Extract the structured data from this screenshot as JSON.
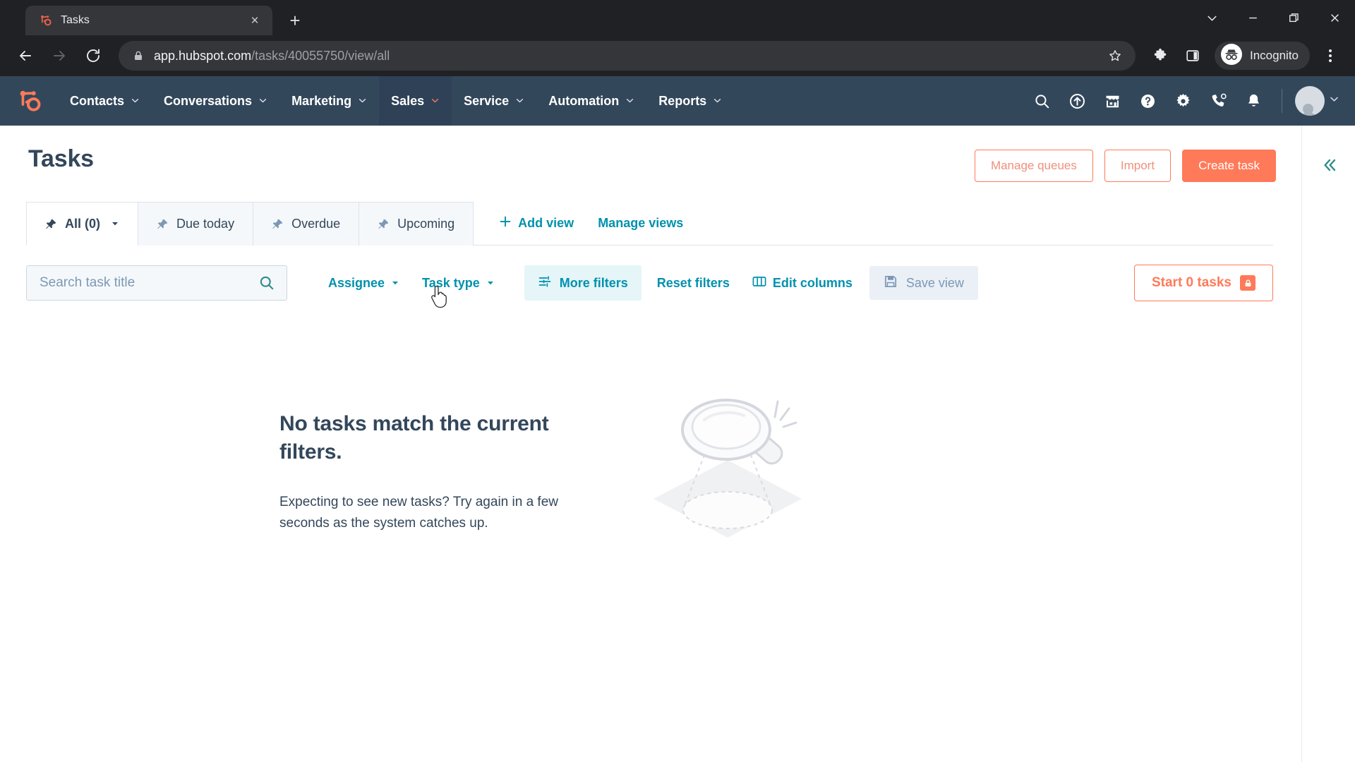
{
  "browser": {
    "tab": {
      "title": "Tasks",
      "favicon": "hubspot-sprocket-icon",
      "close": "×"
    },
    "new_tab_label": "+",
    "window_controls": [
      {
        "name": "tab-search-chevron",
        "glyph": "⌄"
      },
      {
        "name": "minimize",
        "glyph": "—"
      },
      {
        "name": "maximize",
        "glyph": "❐"
      },
      {
        "name": "close",
        "glyph": "✕"
      }
    ],
    "nav": {
      "back": "←",
      "forward": "→",
      "reload": "⟳"
    },
    "omnibox": {
      "host": "app.hubspot.com",
      "path": "/tasks/40055750/view/all",
      "lock": "lock-icon",
      "star": "bookmark-star-icon"
    },
    "extensions_icon": "puzzle-icon",
    "sidepanel_icon": "side-panel-icon",
    "incognito_label": "Incognito",
    "menu_icon": "three-dot-menu-icon"
  },
  "hubspot_nav": {
    "logo": "hubspot-sprocket-logo",
    "menu": [
      {
        "label": "Contacts",
        "active": false
      },
      {
        "label": "Conversations",
        "active": false
      },
      {
        "label": "Marketing",
        "active": false
      },
      {
        "label": "Sales",
        "active": true
      },
      {
        "label": "Service",
        "active": false
      },
      {
        "label": "Automation",
        "active": false
      },
      {
        "label": "Reports",
        "active": false
      }
    ],
    "icons": [
      "search-icon",
      "upgrade-icon",
      "marketplace-icon",
      "help-icon",
      "settings-gear-icon",
      "calling-phone-icon",
      "notifications-bell-icon"
    ],
    "avatar": "user-avatar",
    "avatar_caret": "⌄"
  },
  "page": {
    "title": "Tasks",
    "actions": {
      "manage_queues": "Manage queues",
      "import": "Import",
      "create_task": "Create task"
    },
    "collapse_panel_icon": "double-chevron-left-icon"
  },
  "views": {
    "tabs": [
      {
        "label": "All (0)",
        "active": true,
        "has_caret": true
      },
      {
        "label": "Due today",
        "active": false,
        "has_caret": false
      },
      {
        "label": "Overdue",
        "active": false,
        "has_caret": false
      },
      {
        "label": "Upcoming",
        "active": false,
        "has_caret": false
      }
    ],
    "add_view": "Add view",
    "manage_views": "Manage views"
  },
  "filters": {
    "search_placeholder": "Search task title",
    "search_value": "",
    "assignee": "Assignee",
    "task_type": "Task type",
    "more_filters": "More filters",
    "reset_filters": "Reset filters",
    "edit_columns": "Edit columns",
    "save_view": "Save view",
    "start_tasks": "Start 0 tasks"
  },
  "empty_state": {
    "title": "No tasks match the current filters.",
    "subtitle": "Expecting to see new tasks? Try again in a few seconds as the system catches up.",
    "illustration": "magnifying-glass-illustration"
  },
  "colors": {
    "hubspot_navy": "#33475b",
    "hubspot_orange": "#ff7a59",
    "teal_link": "#0091ae",
    "chip_bg": "#e5f5f8",
    "page_bg": "#ffffff",
    "tab_inactive_bg": "#f5f8fa"
  }
}
